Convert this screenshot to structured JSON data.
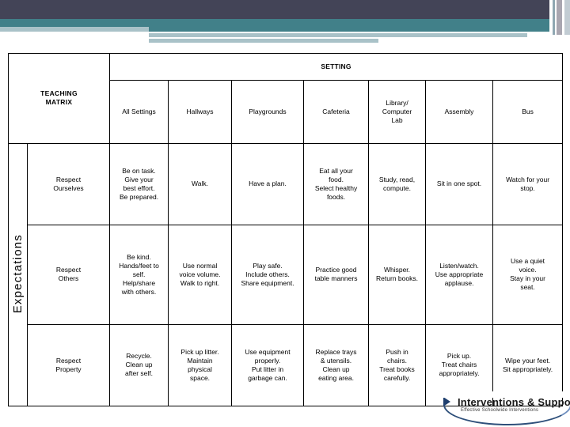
{
  "banner": {
    "colors": {
      "navy": "#434457",
      "teal": "#418089",
      "pale": "#a9c2c8",
      "gray": "#a9a6b0"
    }
  },
  "matrix": {
    "title": "TEACHING\nMATRIX",
    "title_line1": "TEACHING",
    "title_line2": "MATRIX",
    "setting_header": "SETTING",
    "expectations_label": "Expectations",
    "colors": {
      "title_bg": "#ccf49c",
      "header_bg": "#fcf7c4",
      "cell_bg": "#ffffff",
      "border": "#000000"
    },
    "columns": [
      "All Settings",
      "Hallways",
      "Playgrounds",
      "Cafeteria",
      "Library/\nComputer\nLab",
      "Assembly",
      "Bus"
    ],
    "rows": [
      {
        "label": "Respect\nOurselves",
        "label_line1": "Respect",
        "label_line2": "Ourselves",
        "cells": [
          "Be on task.\nGive your\nbest effort.\nBe prepared.",
          "Walk.",
          "Have a plan.",
          "Eat all your\nfood.\nSelect healthy\nfoods.",
          "Study, read,\ncompute.",
          "Sit in one spot.",
          "Watch for your\nstop."
        ]
      },
      {
        "label": "Respect\nOthers",
        "label_line1": "Respect",
        "label_line2": "Others",
        "cells": [
          "Be kind.\nHands/feet to\nself.\nHelp/share\nwith others.",
          "Use normal\nvoice volume.\nWalk to right.",
          "Play safe.\nInclude others.\nShare equipment.",
          "Practice good\ntable manners",
          "Whisper.\nReturn books.",
          "Listen/watch.\nUse appropriate\napplause.",
          "Use a quiet\nvoice.\nStay in your\nseat."
        ]
      },
      {
        "label": "Respect\nProperty",
        "label_line1": "Respect",
        "label_line2": "Property",
        "cells": [
          "Recycle.\nClean up\nafter self.",
          "Pick up litter.\nMaintain\nphysical\nspace.",
          "Use equipment\nproperly.\nPut litter in\ngarbage can.",
          "Replace trays\n& utensils.\nClean up\neating area.",
          "Push in\nchairs.\nTreat books\ncarefully.",
          "Pick up.\nTreat chairs\nappropriately.",
          "Wipe your feet.\nSit appropriately."
        ]
      }
    ]
  },
  "logo": {
    "main_text": "Interventions & Supports",
    "sub_text": "Effective Schoolwide Interventions"
  }
}
